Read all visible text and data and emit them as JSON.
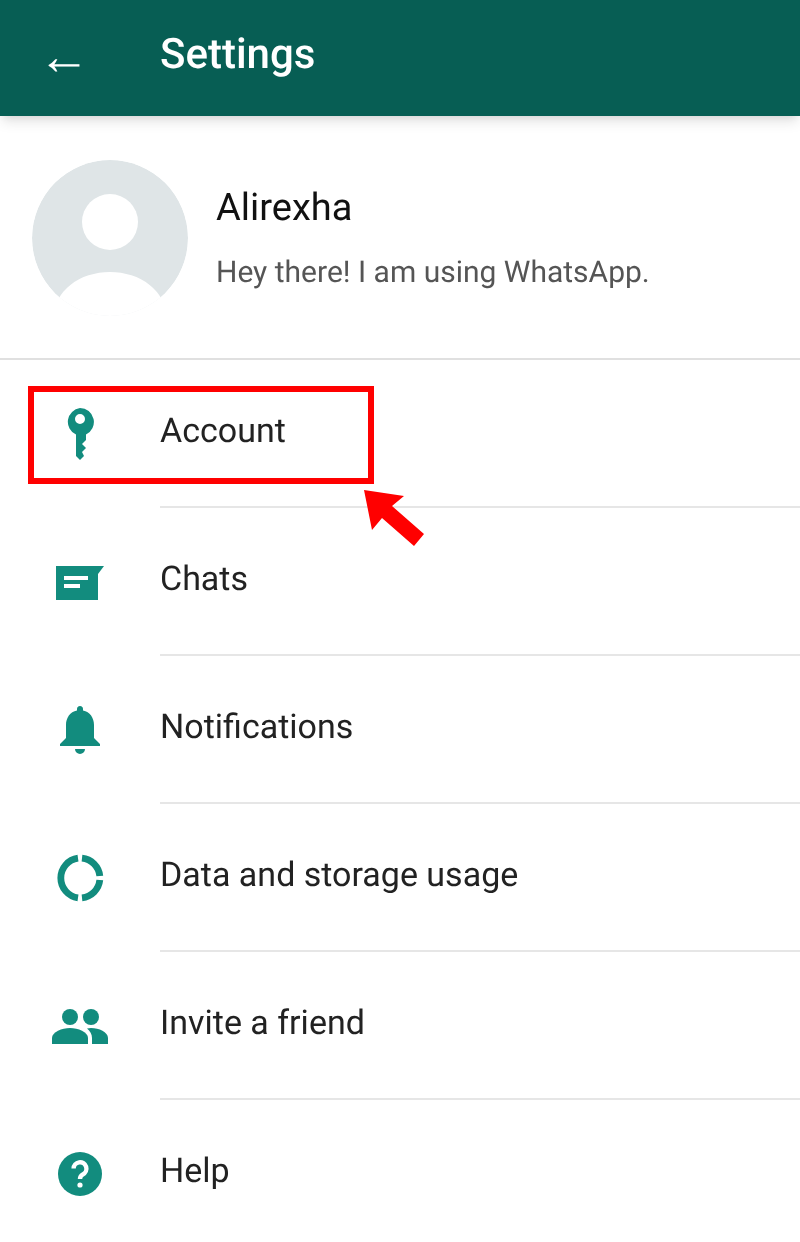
{
  "app_bar": {
    "back": "←",
    "title": "Settings"
  },
  "profile": {
    "name": "Alirexha",
    "status": "Hey there! I am using WhatsApp."
  },
  "items": [
    {
      "label": "Account",
      "highlighted": true
    },
    {
      "label": "Chats",
      "highlighted": false
    },
    {
      "label": "Notifications",
      "highlighted": false
    },
    {
      "label": "Data and storage usage",
      "highlighted": false
    },
    {
      "label": "Invite a friend",
      "highlighted": false
    },
    {
      "label": "Help",
      "highlighted": false
    }
  ]
}
